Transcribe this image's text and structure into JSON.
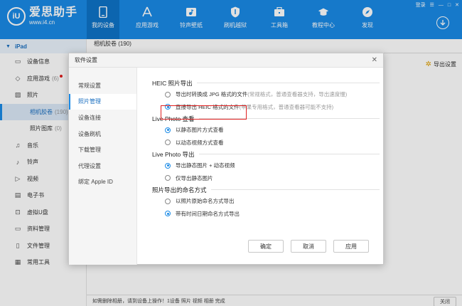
{
  "app": {
    "name": "爱思助手",
    "url": "www.i4.cn",
    "logo_mark": "iU"
  },
  "window_controls": {
    "login": "登录",
    "menu": "☰",
    "minimize": "—",
    "maximize": "□",
    "close": "✕"
  },
  "nav": [
    {
      "label": "我的设备",
      "icon": "phone-icon",
      "active": true
    },
    {
      "label": "应用游戏",
      "icon": "appstore-icon",
      "active": false
    },
    {
      "label": "铃声壁纸",
      "icon": "music-video-icon",
      "active": false
    },
    {
      "label": "刷机越狱",
      "icon": "shield-icon",
      "active": false
    },
    {
      "label": "工具箱",
      "icon": "toolbox-icon",
      "active": false
    },
    {
      "label": "教程中心",
      "icon": "graduation-cap-icon",
      "active": false
    },
    {
      "label": "发现",
      "icon": "compass-icon",
      "active": false
    }
  ],
  "sidebar": {
    "device": "iPad",
    "items": [
      {
        "label": "设备信息",
        "icon": "device-info-icon"
      },
      {
        "label": "应用游戏",
        "count": "(6)",
        "icon": "apps-icon",
        "dot": true
      },
      {
        "label": "照片",
        "icon": "photo-icon"
      },
      {
        "label": "相机胶卷",
        "count": "(190)",
        "icon": "",
        "sub": true,
        "active": true
      },
      {
        "label": "照片图库",
        "count": "(0)",
        "icon": "",
        "sub": true
      },
      {
        "label": "音乐",
        "icon": "music-icon"
      },
      {
        "label": "铃声",
        "icon": "bell-icon"
      },
      {
        "label": "视频",
        "icon": "video-icon"
      },
      {
        "label": "电子书",
        "icon": "ebook-icon"
      },
      {
        "label": "虚拟U盘",
        "icon": "usb-icon"
      },
      {
        "label": "资料管理",
        "icon": "folder-icon"
      },
      {
        "label": "文件管理",
        "icon": "file-icon"
      },
      {
        "label": "常用工具",
        "icon": "grid-icon"
      }
    ]
  },
  "main": {
    "tab": "相机胶卷 (190)",
    "export_settings": "导出设置",
    "bottom_text": "如需删除相册，请到设备上操作！1设备 照片 视频 相册 完成",
    "bottom_button": "关闭"
  },
  "dialog": {
    "title": "软件设置",
    "close": "✕",
    "nav": [
      {
        "label": "常规设置",
        "active": false
      },
      {
        "label": "照片管理",
        "active": true
      },
      {
        "label": "设备连接",
        "active": false
      },
      {
        "label": "设备刷机",
        "active": false
      },
      {
        "label": "下载管理",
        "active": false
      },
      {
        "label": "代理设置",
        "active": false
      },
      {
        "label": "绑定 Apple ID",
        "active": false
      }
    ],
    "sections": [
      {
        "title": "HEIC 照片导出",
        "options": [
          {
            "label": "导出时转换成 JPG 格式的文件",
            "hint": "(常规格式，普通查看器支持，导出速度慢)",
            "checked": false
          },
          {
            "label": "直接导出 HEIC 格式的文件",
            "hint": "(苹果专用格式，普通查看器可能不支持)",
            "checked": true
          }
        ]
      },
      {
        "title": "Live Photo 查看",
        "options": [
          {
            "label": "以静态图片方式查看",
            "hint": "",
            "checked": true
          },
          {
            "label": "以动态视频方式查看",
            "hint": "",
            "checked": false
          }
        ]
      },
      {
        "title": "Live Photo 导出",
        "options": [
          {
            "label": "导出静态图片 + 动态视频",
            "hint": "",
            "checked": true
          },
          {
            "label": "仅导出静态图片",
            "hint": "",
            "checked": false
          }
        ]
      },
      {
        "title": "照片导出的命名方式",
        "options": [
          {
            "label": "以照片原始命名方式导出",
            "hint": "",
            "checked": false
          },
          {
            "label": "带有时间日期命名方式导出",
            "hint": "",
            "checked": true
          }
        ]
      }
    ],
    "buttons": {
      "ok": "确定",
      "cancel": "取消",
      "apply": "应用"
    }
  },
  "colors": {
    "brand": "#1a8ae6",
    "highlight": "#e02020"
  }
}
